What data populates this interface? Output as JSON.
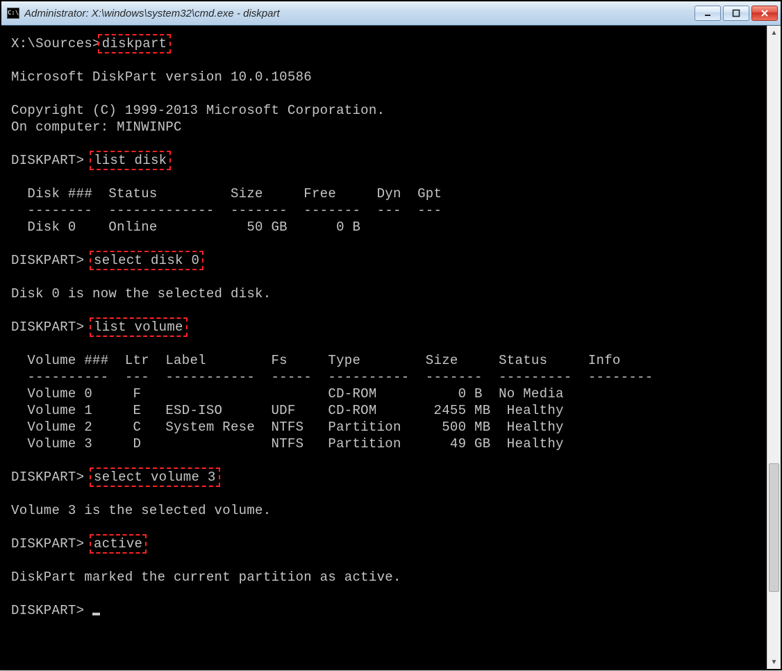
{
  "window": {
    "title": "Administrator: X:\\windows\\system32\\cmd.exe - diskpart"
  },
  "terminal": {
    "prompt1": "X:\\Sources>",
    "cmd_diskpart": "diskpart",
    "blank": "",
    "version_line": "Microsoft DiskPart version 10.0.10586",
    "copyright_line": "Copyright (C) 1999-2013 Microsoft Corporation.",
    "computer_line": "On computer: MINWINPC",
    "diskpart_prompt": "DISKPART> ",
    "cmd_list_disk": "list disk",
    "disk_header": "  Disk ###  Status         Size     Free     Dyn  Gpt",
    "disk_divider": "  --------  -------------  -------  -------  ---  ---",
    "disk_row0": "  Disk 0    Online           50 GB      0 B",
    "cmd_select_disk": "select disk 0",
    "disk_selected_msg": "Disk 0 is now the selected disk.",
    "cmd_list_volume": "list volume",
    "vol_header": "  Volume ###  Ltr  Label        Fs     Type        Size     Status     Info",
    "vol_divider": "  ----------  ---  -----------  -----  ----------  -------  ---------  --------",
    "vol_row0": "  Volume 0     F                       CD-ROM          0 B  No Media",
    "vol_row1": "  Volume 1     E   ESD-ISO      UDF    CD-ROM       2455 MB  Healthy",
    "vol_row2": "  Volume 2     C   System Rese  NTFS   Partition     500 MB  Healthy",
    "vol_row3": "  Volume 3     D                NTFS   Partition      49 GB  Healthy",
    "cmd_select_volume": "select volume 3",
    "vol_selected_msg": "Volume 3 is the selected volume.",
    "cmd_active": "active",
    "active_msg": "DiskPart marked the current partition as active."
  }
}
